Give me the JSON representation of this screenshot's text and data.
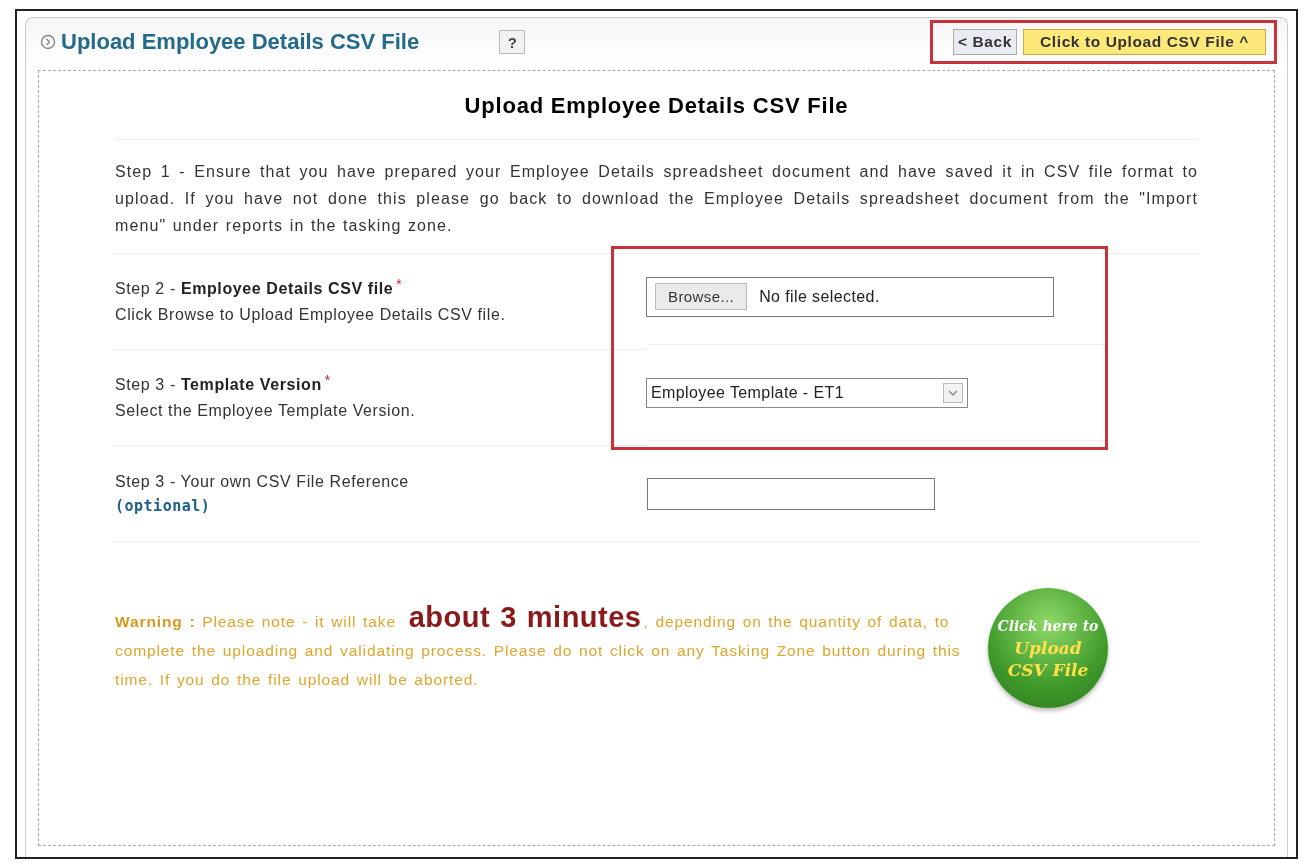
{
  "panel": {
    "title": "Upload Employee Details CSV File",
    "help_button": "?"
  },
  "header_actions": {
    "highlighted": true,
    "buttons": [
      {
        "label": "< Back",
        "kind": "plain"
      },
      {
        "label": "Click to Upload CSV File ^",
        "kind": "primary"
      }
    ]
  },
  "heading": "Upload Employee Details CSV File",
  "intro": "Step 1 - Ensure that you have prepared your Employee Details spreadsheet document and have saved it in CSV file format to upload. If you have not done this please go back to download the Employee Details spreadsheet document from the \"Import menu\" under reports in the tasking zone.",
  "fields_highlighted": true,
  "steps": [
    {
      "kind": "file",
      "step": "Step 2 - ",
      "label": "Employee Details CSV file",
      "mark": "*",
      "hint": "Click Browse to Upload Employee Details CSV file.",
      "button": "Browse...",
      "value": "No file selected."
    },
    {
      "kind": "select",
      "step": "Step 3 - ",
      "label": "Template Version",
      "mark": "*",
      "hint": "Select the Employee Template Version.",
      "value": "Employee Template - ET1"
    },
    {
      "kind": "text",
      "step": "Step 3 - ",
      "label": "Your own CSV File Reference",
      "hint": "(optional)"
    }
  ],
  "warning": "**Warning :** Please note - it will take *about 3 minutes*, depending on the quantity of data, to complete the uploading and validating process. Please do not click on any Tasking Zone button during this time. If you do the file upload will be aborted.",
  "upload_button": [
    "Click here to",
    "Upload",
    "CSV File"
  ]
}
